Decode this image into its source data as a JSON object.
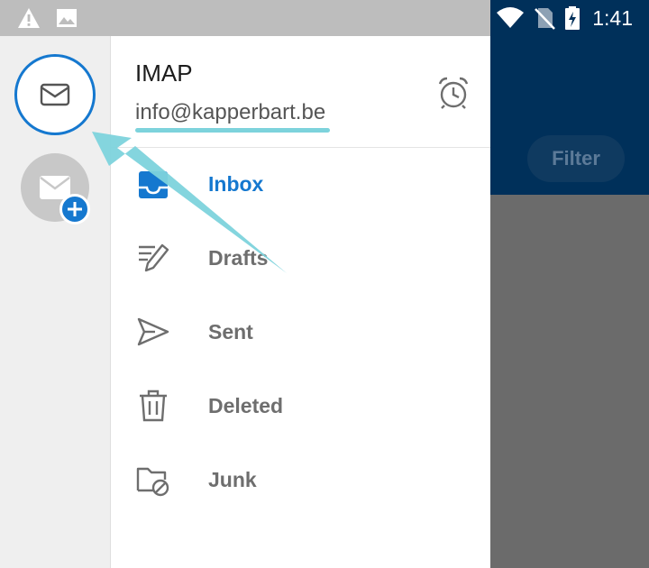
{
  "status_bar": {
    "time": "1:41",
    "left_icons": [
      "warning-icon",
      "image-icon"
    ],
    "right_icons": [
      "wifi-icon",
      "no-sim-icon",
      "battery-charging-icon"
    ]
  },
  "background_app": {
    "filter_label": "Filter"
  },
  "account_rail": {
    "accounts": [
      {
        "icon": "mail-icon",
        "selected": true
      },
      {
        "icon": "mail-add-icon",
        "selected": false
      }
    ]
  },
  "drawer": {
    "account_type": "IMAP",
    "account_email": "info@kapperbart.be",
    "alarm_icon": "alarm-clock-icon",
    "folders": [
      {
        "label": "Inbox",
        "icon": "inbox-icon",
        "active": true
      },
      {
        "label": "Drafts",
        "icon": "drafts-icon",
        "active": false
      },
      {
        "label": "Sent",
        "icon": "sent-icon",
        "active": false
      },
      {
        "label": "Deleted",
        "icon": "trash-icon",
        "active": false
      },
      {
        "label": "Junk",
        "icon": "junk-folder-icon",
        "active": false
      }
    ]
  },
  "colors": {
    "accent": "#1578cf",
    "header_navy": "#00305a",
    "highlight": "#7dd3dc"
  }
}
